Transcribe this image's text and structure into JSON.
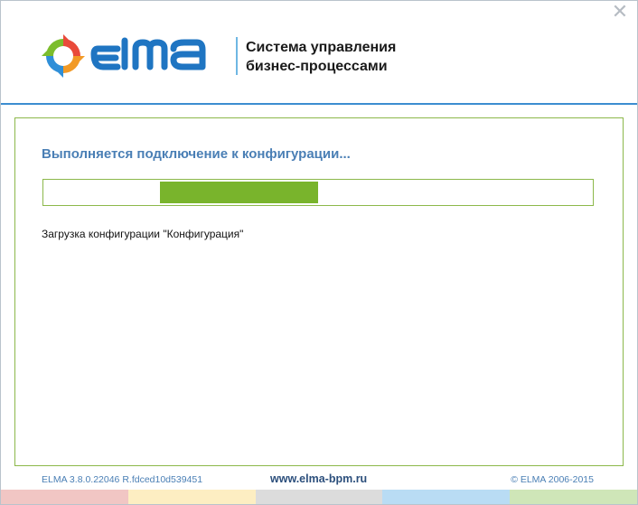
{
  "window": {
    "close_label": "✕"
  },
  "header": {
    "tagline_line1": "Система управления",
    "tagline_line2": "бизнес-процессами"
  },
  "main": {
    "status_title": "Выполняется подключение к конфигурации...",
    "load_message": "Загрузка конфигурации \"Конфигурация\"",
    "progress": {
      "fill_start_fraction": 0.21,
      "fill_end_fraction": 0.5
    }
  },
  "footer": {
    "version": "ELMA 3.8.0.22046 R.fdced10d539451",
    "website": "www.elma-bpm.ru",
    "copyright": "© ELMA 2006-2015"
  },
  "colors": {
    "accent_blue": "#3c8dd0",
    "panel_border_green": "#8cb84a",
    "progress_green": "#79b42c",
    "title_blue": "#4a7fb5",
    "stripes": [
      "#f1c6c4",
      "#fdeec2",
      "#dcdcdc",
      "#b9dcf4",
      "#cfe6b8"
    ]
  },
  "icons": {
    "logo_mark": "circular-arrows-logo-icon",
    "logo_word": "elma-wordmark",
    "close": "close-icon"
  }
}
